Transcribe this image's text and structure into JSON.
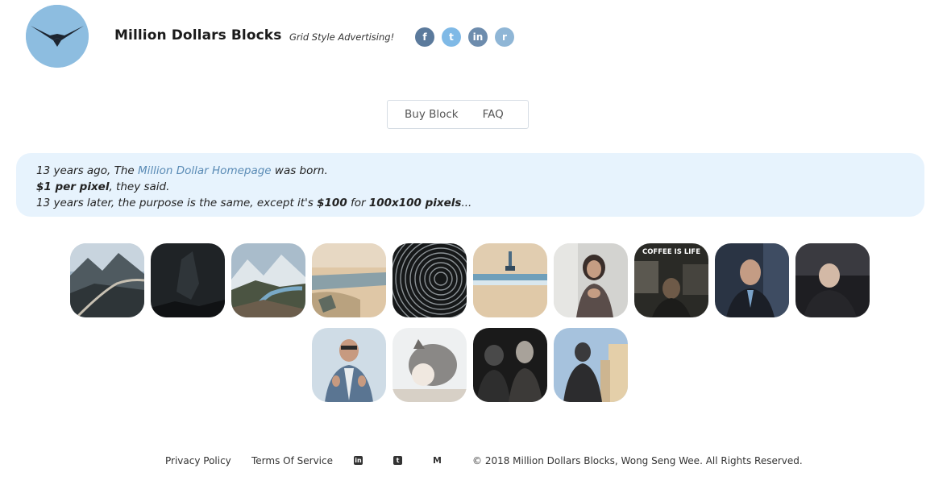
{
  "header": {
    "site_title": "Million Dollars Blocks",
    "tagline": "Grid Style Advertising!",
    "social": [
      {
        "icon": "facebook-icon",
        "glyph": "f"
      },
      {
        "icon": "twitter-icon",
        "glyph": "t"
      },
      {
        "icon": "linkedin-icon",
        "glyph": "in"
      },
      {
        "icon": "reddit-icon",
        "glyph": "r"
      }
    ]
  },
  "nav": {
    "buy_block": "Buy Block",
    "faq": "FAQ"
  },
  "banner": {
    "line1_pre": "13 years ago, The ",
    "line1_link": "Million Dollar Homepage",
    "line1_post": " was born.",
    "line2_bold": "$1 per pixel",
    "line2_post": ", they said.",
    "line3_pre": "13 years later, the purpose is the same, except it's ",
    "line3_price": "$100",
    "line3_mid": " for ",
    "line3_size": "100x100 pixels",
    "line3_post": "..."
  },
  "blocks": [
    {
      "name": "mountain-road"
    },
    {
      "name": "night-sky"
    },
    {
      "name": "mountain-valley-river"
    },
    {
      "name": "beach-scene"
    },
    {
      "name": "star-trails"
    },
    {
      "name": "pixel-art-scene"
    },
    {
      "name": "woman-clapping"
    },
    {
      "name": "coffee-is-life",
      "caption": "COFFEE IS LIFE"
    },
    {
      "name": "man-in-suit"
    },
    {
      "name": "man-laughing"
    },
    {
      "name": "man-thumbs-up"
    },
    {
      "name": "cat"
    },
    {
      "name": "two-people"
    },
    {
      "name": "person-city-street"
    }
  ],
  "footer": {
    "privacy": "Privacy Policy",
    "terms": "Terms Of Service",
    "copyright": "© 2018 Million Dollars Blocks, Wong Seng Wee. All Rights Reserved."
  }
}
